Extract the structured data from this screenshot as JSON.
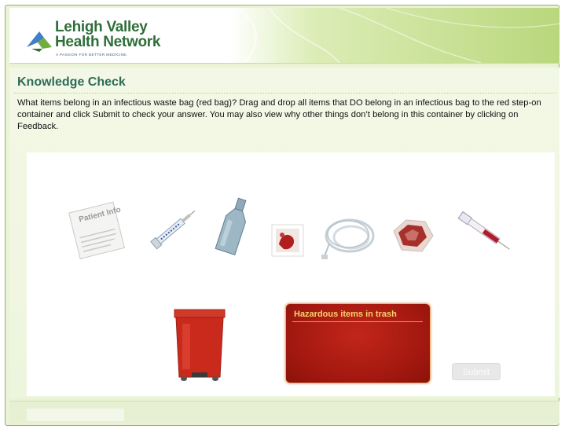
{
  "logo": {
    "line1": "Lehigh Valley",
    "line2": "Health Network",
    "tagline": "A PASSION FOR BETTER MEDICINE."
  },
  "page": {
    "title": "Knowledge Check",
    "instructions": "What items belong in an infectious waste bag (red bag)? Drag and drop all items that DO belong in an infectious bag to the red step-on container and click Submit to check your answer. You may also view why other things don’t belong in this container by clicking on Feedback."
  },
  "items": [
    {
      "icon": "patient-info-paper-icon",
      "label": "Patient Info"
    },
    {
      "icon": "syringe-icon"
    },
    {
      "icon": "glass-bottle-icon"
    },
    {
      "icon": "bloody-gauze-icon"
    },
    {
      "icon": "iv-tubing-icon"
    },
    {
      "icon": "bloody-cloth-icon"
    },
    {
      "icon": "blood-tube-syringe-icon"
    }
  ],
  "container": {
    "icon": "red-step-on-container-icon"
  },
  "hazard_box": {
    "title": "Hazardous items in trash"
  },
  "submit": {
    "label": "Submit",
    "enabled": false
  },
  "colors": {
    "accent_green": "#2f6b5a",
    "hazard_red": "#a0170f",
    "hazard_title": "#f6d36a"
  }
}
